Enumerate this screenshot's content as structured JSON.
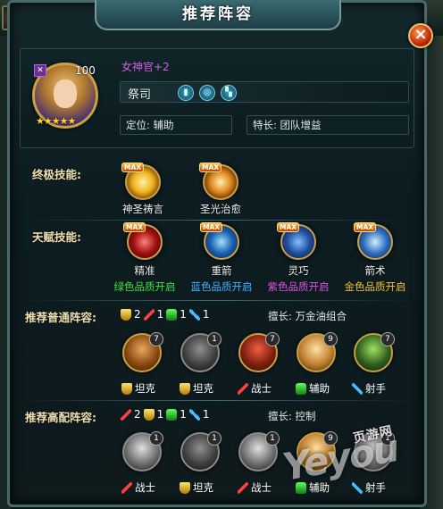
{
  "window": {
    "title": "推荐阵容",
    "close_symbol": "×"
  },
  "background": {
    "slot_level": "7"
  },
  "hero": {
    "name": "女神官+2",
    "level": "100",
    "stars": "★★★★★",
    "class": "祭司",
    "class_icons": [
      "book-icon",
      "target-icon",
      "boot-icon"
    ],
    "position_label": "定位:",
    "position_value": "辅助",
    "specialty_label": "特长:",
    "specialty_value": "团队增益"
  },
  "ultimate": {
    "label": "终极技能:",
    "skills": [
      {
        "name": "神圣祷言",
        "badge": "MAX"
      },
      {
        "name": "圣光治愈",
        "badge": "MAX"
      }
    ]
  },
  "talent": {
    "label": "天赋技能:",
    "skills": [
      {
        "name": "精准",
        "unlock": "绿色品质开启",
        "badge": "MAX"
      },
      {
        "name": "重箭",
        "unlock": "蓝色品质开启",
        "badge": "MAX"
      },
      {
        "name": "灵巧",
        "unlock": "紫色品质开启",
        "badge": "MAX"
      },
      {
        "name": "箭术",
        "unlock": "金色品质开启",
        "badge": "MAX"
      }
    ]
  },
  "normal_team": {
    "label": "推荐普通阵容:",
    "counts": [
      "2",
      "1",
      "1",
      "1"
    ],
    "strength_label": "擅长:",
    "strength_value": "万金油组合",
    "members": [
      {
        "level": "7",
        "role": "坦克"
      },
      {
        "level": "1",
        "role": "坦克"
      },
      {
        "level": "7",
        "role": "战士"
      },
      {
        "level": "9",
        "role": "辅助"
      },
      {
        "level": "7",
        "role": "射手"
      }
    ]
  },
  "high_team": {
    "label": "推荐高配阵容:",
    "counts": [
      "2",
      "1",
      "1",
      "1"
    ],
    "strength_label": "擅长:",
    "strength_value": "控制",
    "members": [
      {
        "level": "1",
        "role": "战士"
      },
      {
        "level": "1",
        "role": "坦克"
      },
      {
        "level": "1",
        "role": "战士"
      },
      {
        "level": "9",
        "role": "辅助"
      },
      {
        "level": "1",
        "role": "射手"
      }
    ]
  },
  "watermark": {
    "site": "页游网",
    "brand": "Yeyou"
  }
}
